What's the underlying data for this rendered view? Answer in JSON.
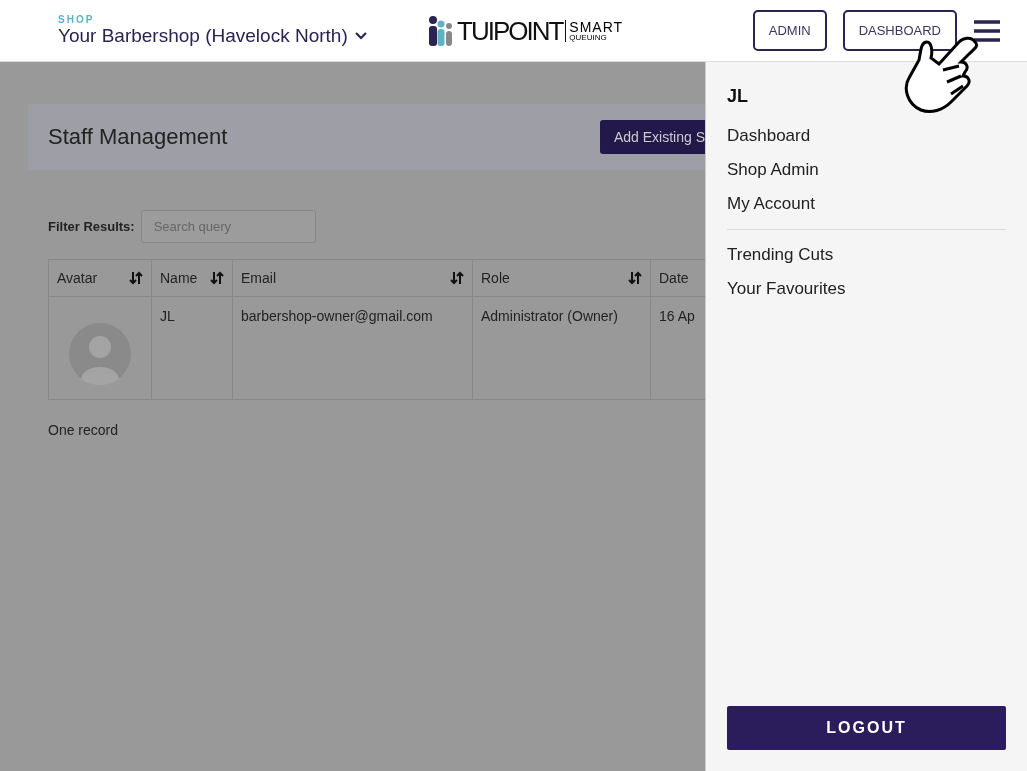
{
  "header": {
    "shop_label": "SHOP",
    "shop_name": "Your Barbershop (Havelock North)",
    "logo_word": "TUIPOINT",
    "logo_smart": "SMART",
    "logo_queuing": "QUEUING",
    "buttons": [
      "ADMIN",
      "DASHBOARD"
    ]
  },
  "page": {
    "title": "Staff Management",
    "action": "Add Existing S",
    "filter_label": "Filter Results:",
    "search": {
      "placeholder": "Search query"
    },
    "table": {
      "columns": [
        {
          "label": "Avatar",
          "sortable": true
        },
        {
          "label": "Name",
          "sortable": true
        },
        {
          "label": "Email",
          "sortable": true
        },
        {
          "label": "Role",
          "sortable": true
        },
        {
          "label": "Date",
          "sortable": false
        }
      ],
      "rows": [
        {
          "name": "JL",
          "email": "barbershop-owner@gmail.com",
          "role": "Administrator (Owner)",
          "date": "16 Ap"
        }
      ]
    },
    "footer": "One record"
  },
  "drawer": {
    "user": "JL",
    "groups": [
      [
        "Dashboard",
        "Shop Admin",
        "My Account"
      ],
      [
        "Trending Cuts",
        "Your Favourites"
      ]
    ],
    "logout": "LOGOUT"
  }
}
